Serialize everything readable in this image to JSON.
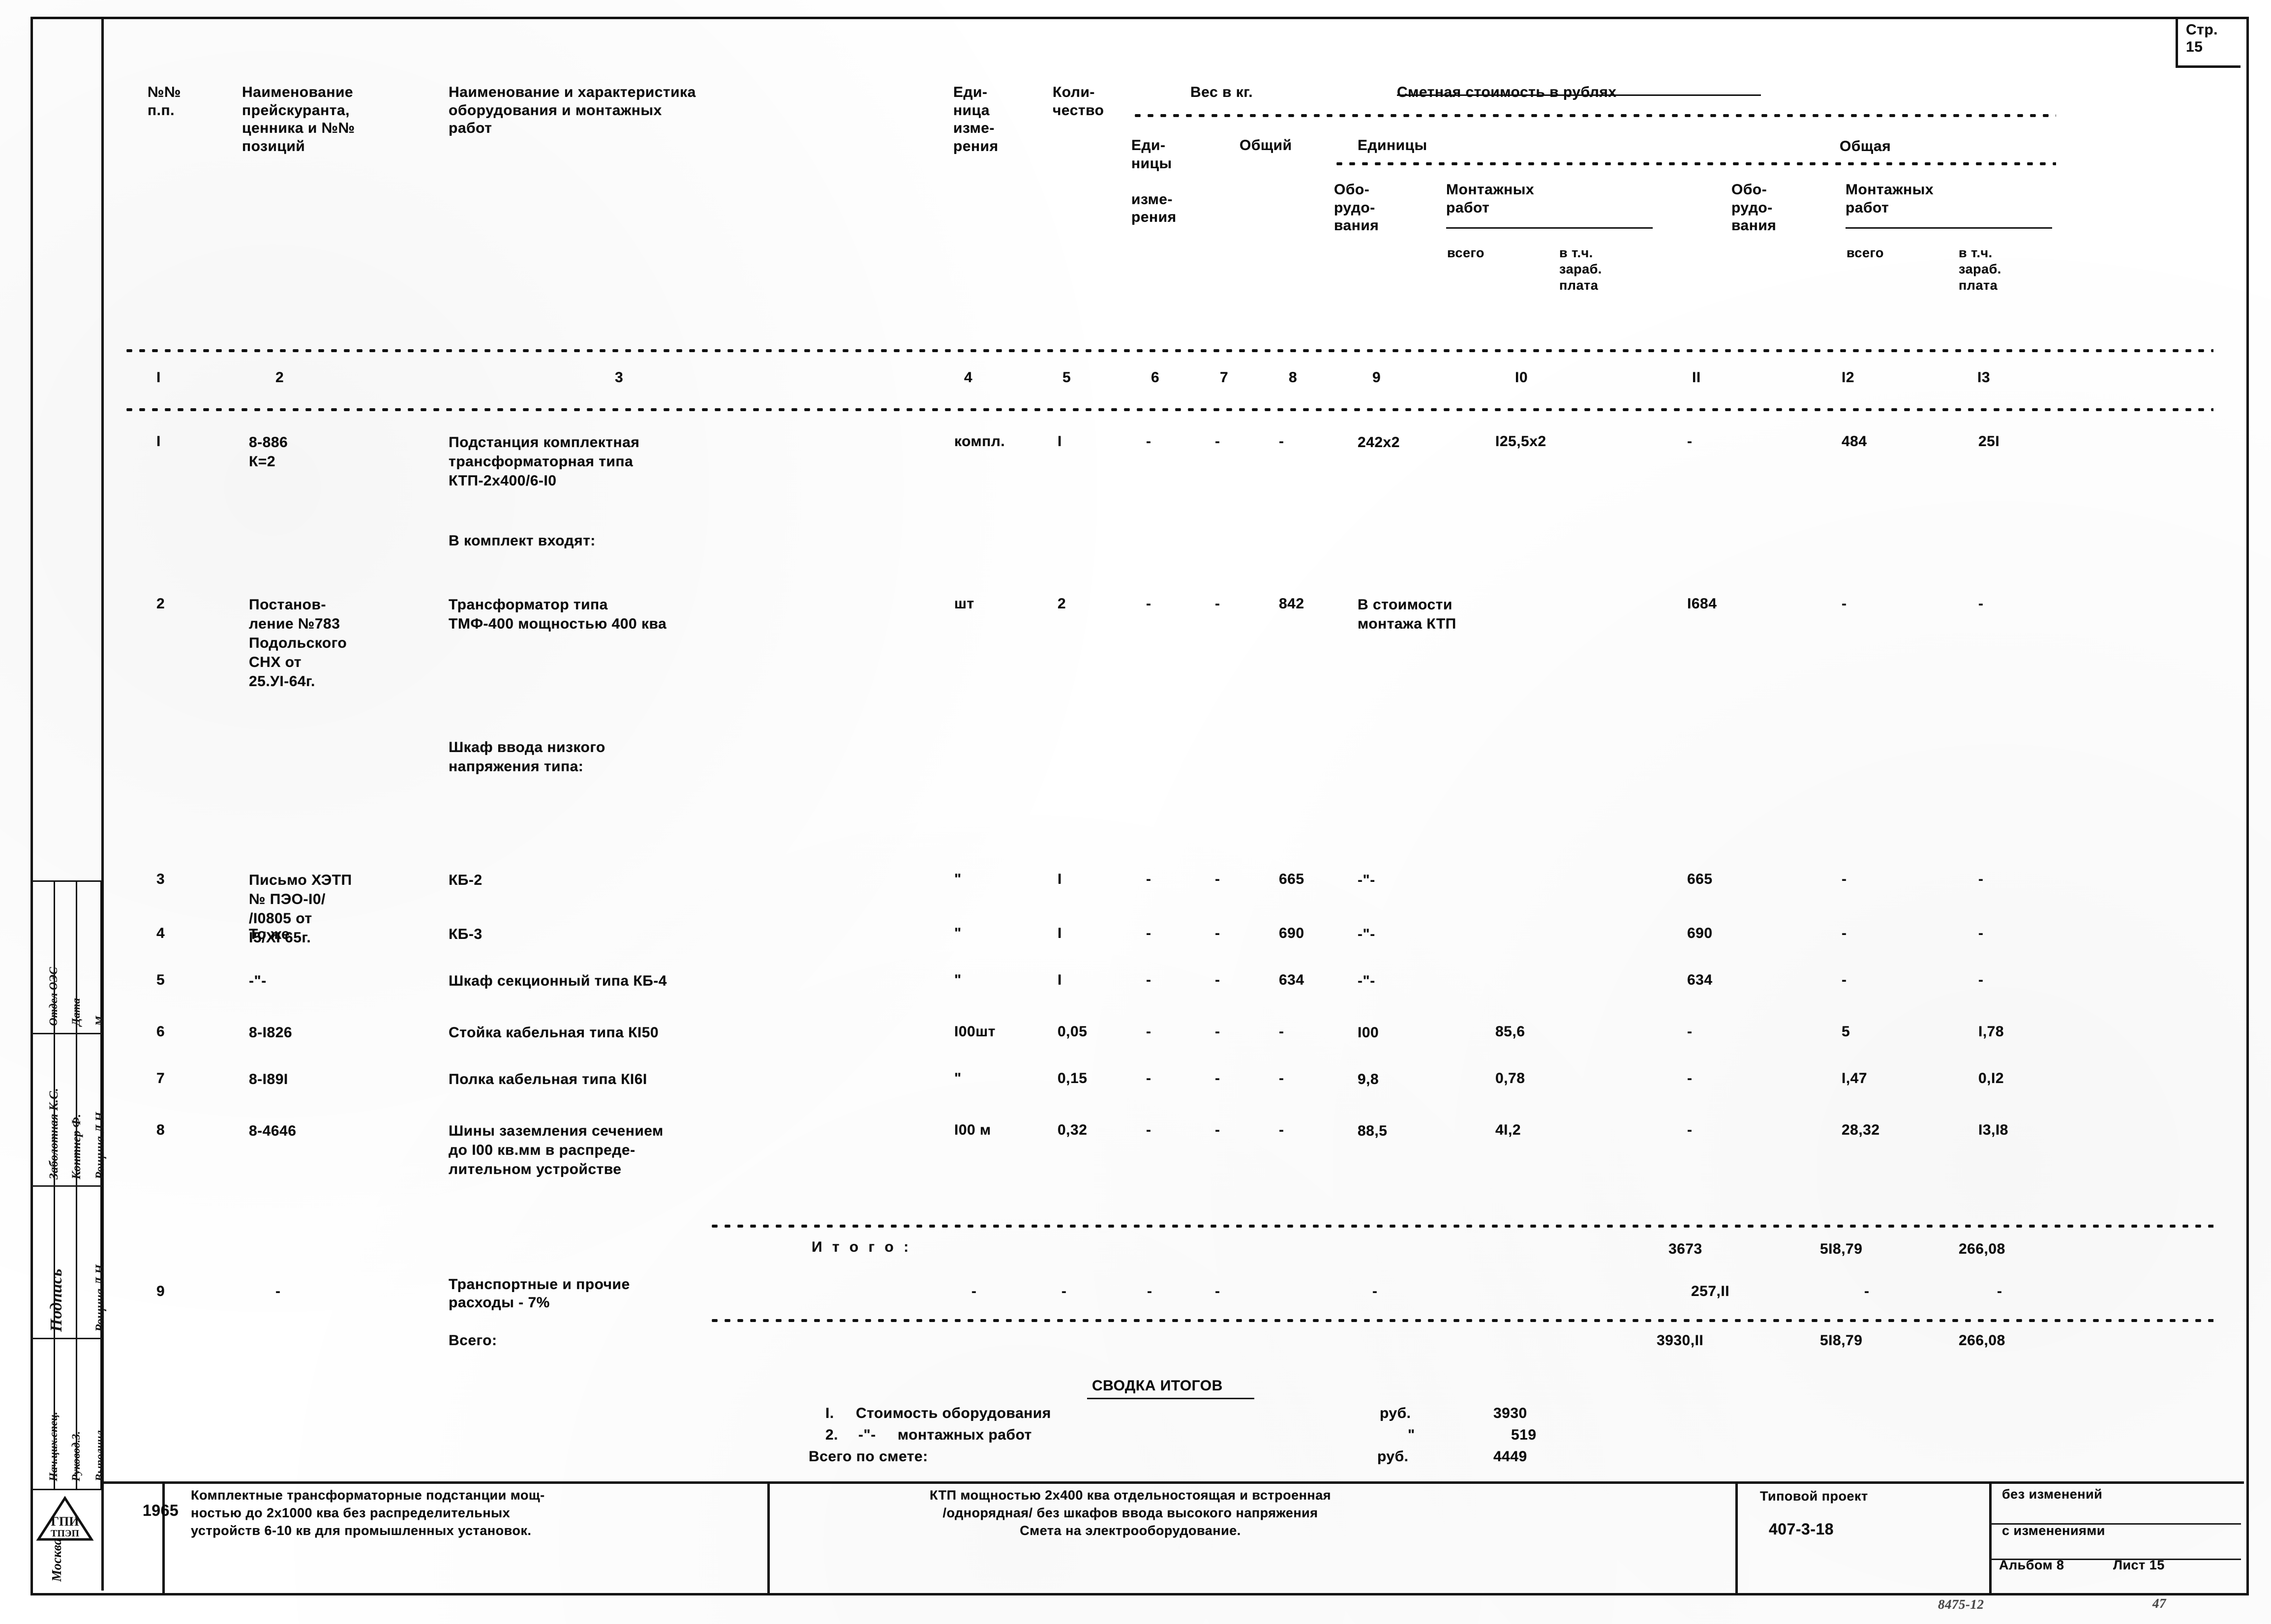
{
  "page_marker": {
    "line1": "Стр.",
    "line2": "15"
  },
  "table": {
    "headers": {
      "col1": "№№\nп.п.",
      "col2": "Наименование\nпрейскуранта,\nценника и №№\nпозиций",
      "col3": "Наименование и характеристика\nоборудования и монтажных\nработ",
      "col4": "Еди-\nница\nизме-\nрения",
      "col5": "Коли-\nчество",
      "weight_group": "Вес в кг.",
      "weight_unit": "Еди-\nницы\n\nизме-\nрения",
      "weight_total": "Общий",
      "cost_group": "Сметная стоимость в рублях",
      "unit_group": "Единицы",
      "unit_equipment": "Обо-\nрудо-\nвания",
      "unit_install": "Монтажных\nработ",
      "unit_install_all": "всего",
      "unit_install_wage": "в т.ч.\nзараб.\nплата",
      "total_group": "Общая",
      "total_equipment": "Обо-\nрудо-\nвания",
      "total_install": "Монтажных\nработ",
      "total_install_all": "всего",
      "total_install_wage": "в т.ч.\nзараб.\nплата"
    },
    "column_numbers": [
      "I",
      "2",
      "3",
      "4",
      "5",
      "6",
      "7",
      "8",
      "9",
      "I0",
      "II",
      "I2",
      "I3"
    ],
    "rows": [
      {
        "no": "I",
        "price_ref": "8-886\nК=2",
        "name": "Подстанция комплектная\nтрансформаторная типа\nКТП-2х400/6-I0",
        "unit": "компл.",
        "qty": "I",
        "w_unit": "-",
        "w_total": "-",
        "c_unit_equip": "-",
        "c_unit_inst_all": "242х2",
        "c_unit_inst_wage": "I25,5х2",
        "c_tot_equip": "-",
        "c_tot_inst_all": "484",
        "c_tot_inst_wage": "25I"
      },
      {
        "no": "",
        "price_ref": "",
        "name": "В комплект входят:",
        "unit": "",
        "qty": "",
        "w_unit": "",
        "w_total": "",
        "c_unit_equip": "",
        "c_unit_inst_all": "",
        "c_unit_inst_wage": "",
        "c_tot_equip": "",
        "c_tot_inst_all": "",
        "c_tot_inst_wage": ""
      },
      {
        "no": "2",
        "price_ref": "Постанов-\nление №783\nПодольского\nСНХ от\n25.УI-64г.",
        "name": "Трансформатор типа\nТМФ-400 мощностью 400 ква",
        "unit": "шт",
        "qty": "2",
        "w_unit": "-",
        "w_total": "-",
        "c_unit_equip": "842",
        "c_unit_inst_all": "В стоимости\nмонтажа КТП",
        "c_unit_inst_wage": "",
        "c_tot_equip": "I684",
        "c_tot_inst_all": "-",
        "c_tot_inst_wage": "-"
      },
      {
        "no": "",
        "price_ref": "",
        "name": "Шкаф ввода низкого\nнапряжения типа:",
        "unit": "",
        "qty": "",
        "w_unit": "",
        "w_total": "",
        "c_unit_equip": "",
        "c_unit_inst_all": "",
        "c_unit_inst_wage": "",
        "c_tot_equip": "",
        "c_tot_inst_all": "",
        "c_tot_inst_wage": ""
      },
      {
        "no": "3",
        "price_ref": "Письмо ХЭТП\n№ ПЭО-I0/\n/I0805 от\nI5/XI 65г.",
        "name": "КБ-2",
        "unit": "\"",
        "qty": "I",
        "w_unit": "-",
        "w_total": "-",
        "c_unit_equip": "665",
        "c_unit_inst_all": "-\"-",
        "c_unit_inst_wage": "",
        "c_tot_equip": "665",
        "c_tot_inst_all": "-",
        "c_tot_inst_wage": "-"
      },
      {
        "no": "4",
        "price_ref": "То же",
        "name": "КБ-3",
        "unit": "\"",
        "qty": "I",
        "w_unit": "-",
        "w_total": "-",
        "c_unit_equip": "690",
        "c_unit_inst_all": "-\"-",
        "c_unit_inst_wage": "",
        "c_tot_equip": "690",
        "c_tot_inst_all": "-",
        "c_tot_inst_wage": "-"
      },
      {
        "no": "5",
        "price_ref": "-\"-",
        "name": "Шкаф секционный типа КБ-4",
        "unit": "\"",
        "qty": "I",
        "w_unit": "-",
        "w_total": "-",
        "c_unit_equip": "634",
        "c_unit_inst_all": "-\"-",
        "c_unit_inst_wage": "",
        "c_tot_equip": "634",
        "c_tot_inst_all": "-",
        "c_tot_inst_wage": "-"
      },
      {
        "no": "6",
        "price_ref": "8-I826",
        "name": "Стойка кабельная типа КI50",
        "unit": "I00шт",
        "qty": "0,05",
        "w_unit": "-",
        "w_total": "-",
        "c_unit_equip": "-",
        "c_unit_inst_all": "I00",
        "c_unit_inst_wage": "85,6",
        "c_tot_equip": "-",
        "c_tot_inst_all": "5",
        "c_tot_inst_wage": "I,78"
      },
      {
        "no": "7",
        "price_ref": "8-I89I",
        "name": "Полка кабельная типа КI6I",
        "unit": "\"",
        "qty": "0,15",
        "w_unit": "-",
        "w_total": "-",
        "c_unit_equip": "-",
        "c_unit_inst_all": "9,8",
        "c_unit_inst_wage": "0,78",
        "c_tot_equip": "-",
        "c_tot_inst_all": "I,47",
        "c_tot_inst_wage": "0,I2"
      },
      {
        "no": "8",
        "price_ref": "8-4646",
        "name": "Шины заземления сечением\nдо I00 кв.мм в распреде-\nлительном устройстве",
        "unit": "I00 м",
        "qty": "0,32",
        "w_unit": "-",
        "w_total": "-",
        "c_unit_equip": "-",
        "c_unit_inst_all": "88,5",
        "c_unit_inst_wage": "4I,2",
        "c_tot_equip": "-",
        "c_tot_inst_all": "28,32",
        "c_tot_inst_wage": "I3,I8"
      }
    ],
    "subtotal": {
      "label": "И т о г о :",
      "equipment": "3673",
      "install_all": "5I8,79",
      "install_wage": "266,08"
    },
    "transport": {
      "no": "9",
      "price_ref": "-",
      "label": "Транспортные и прочие\nрасходы - 7%",
      "unit": "-",
      "qty": "-",
      "w_unit": "-",
      "w_total": "-",
      "c_unit_equip": "-",
      "equipment": "257,II",
      "install_all": "-",
      "install_wage": "-"
    },
    "grandtotal": {
      "label": "Всего:",
      "equipment": "3930,II",
      "install_all": "5I8,79",
      "install_wage": "266,08"
    }
  },
  "summary": {
    "title": "СВОДКА ИТОГОВ",
    "lines": [
      {
        "no": "I.",
        "label": "Стоимость оборудования",
        "unit": "руб.",
        "value": "3930"
      },
      {
        "no": "2.",
        "label": "-\"-     монтажных работ",
        "unit": "\"",
        "value": "519"
      }
    ],
    "total_label": "Всего по смете:",
    "total_unit": "руб.",
    "total_value": "4449"
  },
  "stamp": {
    "city": "Москва",
    "roles": [
      "Нач.цих.спец.",
      "Руковод.3.",
      "Выполнил"
    ],
    "names": [
      "Заболотная К.С.",
      "Контнер Ф.",
      "Рощина Л.Н."
    ],
    "extra": [
      "Отдел ОЭС",
      "Дата",
      "М"
    ],
    "signature": "Подпись"
  },
  "titleblock": {
    "year": "1965",
    "object": "Комплектные трансформаторные подстанции мощ-\nностью до 2х1000 ква без распределительных\nустройств 6-10 кв для промышленных установок.",
    "description": "КТП мощностью 2х400 ква отдельностоящая и встроенная\n/однорядная/ без шкафов ввода высокого напряжения\nСмета на электрооборудование.",
    "project_label": "Типовой проект",
    "project_number": "407-3-18",
    "rev_none": "без изменений",
    "rev_with": "с изменениями",
    "album": "Альбом 8",
    "sheet": "Лист 15"
  },
  "marginalia": {
    "bottom_left": "8475-12",
    "bottom_right": "47"
  }
}
